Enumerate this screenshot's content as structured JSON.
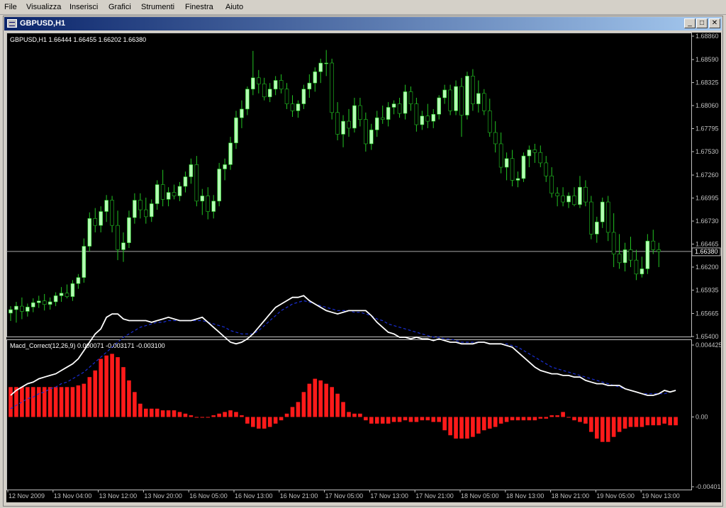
{
  "menu": [
    "File",
    "Visualizza",
    "Inserisci",
    "Grafici",
    "Strumenti",
    "Finestra",
    "Aiuto"
  ],
  "window": {
    "title": "GBPUSD,H1",
    "minimize": "_",
    "maximize": "□",
    "close": "✕"
  },
  "colors": {
    "background": "#000000",
    "bull": "#b3ffb3",
    "wick": "#22c422",
    "histogram": "#ff1a1a",
    "macd_line": "#ffffff",
    "signal_line": "#1a2ed6",
    "axis": "#c0c0c0"
  },
  "price_panel": {
    "label": "GBPUSD,H1  1.66444 1.66455 1.66202 1.66380",
    "price_ticks": [
      "1.68860",
      "1.68590",
      "1.68325",
      "1.68060",
      "1.67795",
      "1.67530",
      "1.67260",
      "1.66995",
      "1.66730",
      "1.66465",
      "1.66200",
      "1.65935",
      "1.65665",
      "1.65400"
    ],
    "current_price": "1.66380"
  },
  "macd_panel": {
    "label": "Macd_Correct(12,26,9) 0.000071 -0.003171 -0.003100",
    "ticks": [
      "0.004425",
      "0.00",
      "-0.00401"
    ]
  },
  "time_ticks": [
    "12 Nov 2009",
    "13 Nov 04:00",
    "13 Nov 12:00",
    "13 Nov 20:00",
    "16 Nov 05:00",
    "16 Nov 13:00",
    "16 Nov 21:00",
    "17 Nov 05:00",
    "17 Nov 13:00",
    "17 Nov 21:00",
    "18 Nov 05:00",
    "18 Nov 13:00",
    "18 Nov 21:00",
    "19 Nov 05:00",
    "19 Nov 13:00"
  ],
  "chart_data": {
    "type": "candlestick",
    "symbol": "GBPUSD",
    "timeframe": "H1",
    "price_ylim": [
      1.654,
      1.6886
    ],
    "candles": [
      [
        1.6567,
        1.6575,
        1.6558,
        1.6571
      ],
      [
        1.6571,
        1.658,
        1.6556,
        1.6575
      ],
      [
        1.6575,
        1.6585,
        1.656,
        1.6569
      ],
      [
        1.6569,
        1.6578,
        1.6563,
        1.6574
      ],
      [
        1.6574,
        1.6584,
        1.6568,
        1.6579
      ],
      [
        1.6579,
        1.6587,
        1.6573,
        1.6581
      ],
      [
        1.6581,
        1.6589,
        1.657,
        1.6577
      ],
      [
        1.6577,
        1.6585,
        1.6571,
        1.658
      ],
      [
        1.658,
        1.6591,
        1.6575,
        1.6587
      ],
      [
        1.6587,
        1.6597,
        1.658,
        1.659
      ],
      [
        1.659,
        1.66,
        1.6584,
        1.6586
      ],
      [
        1.6586,
        1.6605,
        1.6581,
        1.6601
      ],
      [
        1.6601,
        1.6612,
        1.6595,
        1.6608
      ],
      [
        1.6608,
        1.6653,
        1.6602,
        1.6644
      ],
      [
        1.6644,
        1.6683,
        1.6638,
        1.6676
      ],
      [
        1.6676,
        1.6688,
        1.666,
        1.6668
      ],
      [
        1.6668,
        1.669,
        1.666,
        1.6684
      ],
      [
        1.6684,
        1.6703,
        1.6672,
        1.6697
      ],
      [
        1.6697,
        1.6702,
        1.666,
        1.6668
      ],
      [
        1.6668,
        1.6685,
        1.6628,
        1.664
      ],
      [
        1.664,
        1.666,
        1.6626,
        1.6648
      ],
      [
        1.6648,
        1.6685,
        1.6642,
        1.6677
      ],
      [
        1.6677,
        1.6705,
        1.667,
        1.6697
      ],
      [
        1.6697,
        1.6705,
        1.6676,
        1.6686
      ],
      [
        1.6686,
        1.67,
        1.667,
        1.6678
      ],
      [
        1.6678,
        1.6698,
        1.6672,
        1.6693
      ],
      [
        1.6693,
        1.672,
        1.6686,
        1.6715
      ],
      [
        1.6715,
        1.6732,
        1.669,
        1.6698
      ],
      [
        1.6698,
        1.6712,
        1.669,
        1.6706
      ],
      [
        1.6706,
        1.6715,
        1.6698,
        1.6702
      ],
      [
        1.6702,
        1.6718,
        1.6696,
        1.6713
      ],
      [
        1.6713,
        1.673,
        1.6706,
        1.6724
      ],
      [
        1.6724,
        1.6745,
        1.6716,
        1.6738
      ],
      [
        1.6738,
        1.6748,
        1.669,
        1.6696
      ],
      [
        1.6696,
        1.671,
        1.668,
        1.6702
      ],
      [
        1.6702,
        1.6712,
        1.6675,
        1.6684
      ],
      [
        1.6684,
        1.6703,
        1.6676,
        1.6696
      ],
      [
        1.6696,
        1.674,
        1.669,
        1.6733
      ],
      [
        1.6733,
        1.6745,
        1.672,
        1.6738
      ],
      [
        1.6738,
        1.677,
        1.6732,
        1.6763
      ],
      [
        1.6763,
        1.68,
        1.6756,
        1.6792
      ],
      [
        1.6792,
        1.6812,
        1.678,
        1.6802
      ],
      [
        1.6802,
        1.6828,
        1.6795,
        1.6825
      ],
      [
        1.6825,
        1.6869,
        1.6818,
        1.6838
      ],
      [
        1.6838,
        1.6847,
        1.682,
        1.6831
      ],
      [
        1.6831,
        1.6838,
        1.6812,
        1.6816
      ],
      [
        1.6816,
        1.6832,
        1.681,
        1.6825
      ],
      [
        1.6825,
        1.684,
        1.6818,
        1.6835
      ],
      [
        1.6835,
        1.6842,
        1.682,
        1.6825
      ],
      [
        1.6825,
        1.6832,
        1.6802,
        1.6808
      ],
      [
        1.6808,
        1.6818,
        1.6793,
        1.68
      ],
      [
        1.68,
        1.6812,
        1.6792,
        1.6808
      ],
      [
        1.6808,
        1.683,
        1.6802,
        1.6825
      ],
      [
        1.6825,
        1.6842,
        1.6815,
        1.6832
      ],
      [
        1.6832,
        1.685,
        1.6822,
        1.6845
      ],
      [
        1.6845,
        1.686,
        1.6832,
        1.6855
      ],
      [
        1.6855,
        1.687,
        1.684,
        1.6855
      ],
      [
        1.6855,
        1.686,
        1.679,
        1.6798
      ],
      [
        1.6798,
        1.681,
        1.6766,
        1.6773
      ],
      [
        1.6773,
        1.6795,
        1.6758,
        1.6788
      ],
      [
        1.6788,
        1.6802,
        1.677,
        1.678
      ],
      [
        1.678,
        1.6815,
        1.6775,
        1.6806
      ],
      [
        1.6806,
        1.6815,
        1.6782,
        1.679
      ],
      [
        1.679,
        1.6798,
        1.6753,
        1.6762
      ],
      [
        1.6762,
        1.6785,
        1.6755,
        1.6778
      ],
      [
        1.6778,
        1.68,
        1.677,
        1.6792
      ],
      [
        1.6792,
        1.6806,
        1.6785,
        1.679
      ],
      [
        1.679,
        1.681,
        1.6782,
        1.6804
      ],
      [
        1.6804,
        1.6812,
        1.6796,
        1.6808
      ],
      [
        1.6808,
        1.6815,
        1.6792,
        1.6797
      ],
      [
        1.6797,
        1.683,
        1.679,
        1.6822
      ],
      [
        1.6822,
        1.6828,
        1.68,
        1.6808
      ],
      [
        1.6808,
        1.6815,
        1.6776,
        1.6784
      ],
      [
        1.6784,
        1.68,
        1.6778,
        1.6794
      ],
      [
        1.6794,
        1.6808,
        1.678,
        1.6788
      ],
      [
        1.6788,
        1.6802,
        1.678,
        1.6796
      ],
      [
        1.6796,
        1.6818,
        1.679,
        1.6815
      ],
      [
        1.6815,
        1.683,
        1.6808,
        1.6824
      ],
      [
        1.6824,
        1.683,
        1.6795,
        1.68
      ],
      [
        1.68,
        1.6835,
        1.6795,
        1.6828
      ],
      [
        1.6828,
        1.6838,
        1.677,
        1.6795
      ],
      [
        1.6795,
        1.6845,
        1.679,
        1.684
      ],
      [
        1.684,
        1.6848,
        1.68,
        1.6808
      ],
      [
        1.6808,
        1.6835,
        1.6798,
        1.682
      ],
      [
        1.682,
        1.6825,
        1.6795,
        1.68
      ],
      [
        1.68,
        1.6814,
        1.677,
        1.6775
      ],
      [
        1.6775,
        1.6788,
        1.6752,
        1.6762
      ],
      [
        1.6762,
        1.6775,
        1.6728,
        1.6735
      ],
      [
        1.6735,
        1.6752,
        1.672,
        1.6745
      ],
      [
        1.6745,
        1.6755,
        1.6713,
        1.672
      ],
      [
        1.672,
        1.673,
        1.6712,
        1.6722
      ],
      [
        1.6722,
        1.6752,
        1.6718,
        1.6748
      ],
      [
        1.6748,
        1.676,
        1.6735,
        1.6755
      ],
      [
        1.6755,
        1.6762,
        1.674,
        1.6752
      ],
      [
        1.6752,
        1.676,
        1.6735,
        1.674
      ],
      [
        1.674,
        1.6748,
        1.6718,
        1.6725
      ],
      [
        1.6725,
        1.6735,
        1.67,
        1.6705
      ],
      [
        1.6705,
        1.6712,
        1.669,
        1.6702
      ],
      [
        1.6702,
        1.6712,
        1.669,
        1.6695
      ],
      [
        1.6695,
        1.6706,
        1.6688,
        1.6702
      ],
      [
        1.6702,
        1.6712,
        1.669,
        1.6692
      ],
      [
        1.6692,
        1.6725,
        1.6688,
        1.6712
      ],
      [
        1.6712,
        1.672,
        1.669,
        1.6695
      ],
      [
        1.6695,
        1.6702,
        1.6652,
        1.6658
      ],
      [
        1.6658,
        1.6678,
        1.6648,
        1.6672
      ],
      [
        1.6672,
        1.67,
        1.6665,
        1.6695
      ],
      [
        1.6695,
        1.6702,
        1.665,
        1.666
      ],
      [
        1.666,
        1.6682,
        1.662,
        1.6635
      ],
      [
        1.6635,
        1.6658,
        1.6618,
        1.6625
      ],
      [
        1.6625,
        1.6648,
        1.6615,
        1.664
      ],
      [
        1.664,
        1.6655,
        1.662,
        1.6628
      ],
      [
        1.6628,
        1.664,
        1.6605,
        1.6612
      ],
      [
        1.6612,
        1.6632,
        1.6608,
        1.6618
      ],
      [
        1.6618,
        1.6658,
        1.6612,
        1.665
      ],
      [
        1.665,
        1.6663,
        1.6635,
        1.664
      ],
      [
        1.664,
        1.6648,
        1.662,
        1.6638
      ]
    ],
    "macd": [
      0.0013,
      0.0016,
      0.0018,
      0.002,
      0.0021,
      0.0023,
      0.0024,
      0.0025,
      0.0026,
      0.0028,
      0.003,
      0.0032,
      0.0035,
      0.004,
      0.0045,
      0.005,
      0.0053,
      0.006,
      0.0062,
      0.0062,
      0.0059,
      0.0058,
      0.0058,
      0.0058,
      0.0058,
      0.0057,
      0.0058,
      0.0059,
      0.006,
      0.0059,
      0.0058,
      0.0058,
      0.0058,
      0.0059,
      0.006,
      0.0057,
      0.0054,
      0.0051,
      0.0048,
      0.0045,
      0.0044,
      0.0045,
      0.0047,
      0.005,
      0.0054,
      0.0058,
      0.0062,
      0.0066,
      0.0068,
      0.007,
      0.0072,
      0.0072,
      0.0073,
      0.007,
      0.0068,
      0.0066,
      0.0064,
      0.0063,
      0.0062,
      0.0063,
      0.0064,
      0.0064,
      0.0064,
      0.0064,
      0.0061,
      0.0057,
      0.0054,
      0.0051,
      0.005,
      0.0048,
      0.0048,
      0.0047,
      0.0048,
      0.0047,
      0.0047,
      0.0046,
      0.0047,
      0.0046,
      0.0045,
      0.0045,
      0.0044,
      0.0044,
      0.0044,
      0.0045,
      0.0045,
      0.0044,
      0.0044,
      0.0044,
      0.0043,
      0.0042,
      0.0039,
      0.0036,
      0.0033,
      0.003,
      0.0028,
      0.0027,
      0.0026,
      0.0026,
      0.0025,
      0.0025,
      0.0024,
      0.0024,
      0.0022,
      0.0021,
      0.002,
      0.002,
      0.0019,
      0.0019,
      0.0019,
      0.0017,
      0.0016,
      0.0015,
      0.0014,
      0.0013,
      0.0013,
      0.0014,
      0.0016,
      0.0015,
      0.0016
    ],
    "signal": [
      0.0005,
      0.0007,
      0.0009,
      0.0011,
      0.0012,
      0.0014,
      0.0015,
      0.0017,
      0.0018,
      0.002,
      0.0021,
      0.0023,
      0.0025,
      0.0027,
      0.003,
      0.0033,
      0.0036,
      0.0039,
      0.0042,
      0.0045,
      0.0048,
      0.005,
      0.0052,
      0.0054,
      0.0055,
      0.0056,
      0.0057,
      0.0057,
      0.0058,
      0.0058,
      0.0058,
      0.0058,
      0.0058,
      0.0058,
      0.0058,
      0.0057,
      0.0056,
      0.0055,
      0.0054,
      0.0052,
      0.0051,
      0.005,
      0.005,
      0.005,
      0.0052,
      0.0055,
      0.0058,
      0.0061,
      0.0064,
      0.0066,
      0.0068,
      0.0069,
      0.007,
      0.0069,
      0.0068,
      0.0067,
      0.0066,
      0.0065,
      0.0064,
      0.0064,
      0.0064,
      0.0063,
      0.0063,
      0.0062,
      0.0061,
      0.0059,
      0.0058,
      0.0056,
      0.0055,
      0.0054,
      0.0053,
      0.0052,
      0.0051,
      0.005,
      0.0049,
      0.0048,
      0.0048,
      0.0047,
      0.0047,
      0.0046,
      0.0045,
      0.0045,
      0.0045,
      0.0045,
      0.0045,
      0.0044,
      0.0044,
      0.0044,
      0.0044,
      0.0043,
      0.0042,
      0.004,
      0.0038,
      0.0036,
      0.0034,
      0.0032,
      0.003,
      0.0029,
      0.0028,
      0.0027,
      0.0026,
      0.0025,
      0.0024,
      0.0023,
      0.0022,
      0.0021,
      0.002,
      0.0019,
      0.0018,
      0.0017,
      0.0016,
      0.0015,
      0.0014,
      0.0014,
      0.0014,
      0.0014,
      0.0014,
      0.0015,
      0.0016
    ],
    "histogram": [
      0.0018,
      0.0018,
      0.0018,
      0.0018,
      0.0018,
      0.0018,
      0.0018,
      0.0018,
      0.0018,
      0.0018,
      0.0018,
      0.0018,
      0.0019,
      0.002,
      0.0024,
      0.0028,
      0.0035,
      0.0037,
      0.0038,
      0.0036,
      0.003,
      0.0022,
      0.0015,
      0.0008,
      0.0005,
      0.0005,
      0.0005,
      0.0004,
      0.0004,
      0.0004,
      0.0003,
      0.0002,
      0.0001,
      0.0,
      0.0,
      0.0,
      0.0001,
      0.0002,
      0.0003,
      0.0004,
      0.0003,
      0.0001,
      -0.0004,
      -0.0006,
      -0.0007,
      -0.0007,
      -0.0006,
      -0.0004,
      -0.0002,
      0.0002,
      0.0006,
      0.0009,
      0.0015,
      0.002,
      0.0023,
      0.0022,
      0.002,
      0.0018,
      0.0014,
      0.0009,
      0.0003,
      0.0002,
      0.0002,
      -0.0002,
      -0.0004,
      -0.0004,
      -0.0004,
      -0.0004,
      -0.0003,
      -0.0003,
      -0.0002,
      -0.0003,
      -0.0003,
      -0.0002,
      -0.0002,
      -0.0003,
      -0.0003,
      -0.0008,
      -0.0011,
      -0.0013,
      -0.0013,
      -0.0013,
      -0.0012,
      -0.001,
      -0.0008,
      -0.0007,
      -0.0006,
      -0.0004,
      -0.0003,
      -0.0002,
      -0.0002,
      -0.0002,
      -0.0002,
      -0.0002,
      -0.0001,
      -0.0001,
      0.0001,
      0.0001,
      0.0003,
      0.0,
      -0.0002,
      -0.0003,
      -0.0004,
      -0.0009,
      -0.0013,
      -0.0015,
      -0.0015,
      -0.0012,
      -0.0009,
      -0.0007,
      -0.0006,
      -0.0006,
      -0.0006,
      -0.0005,
      -0.0005,
      -0.0005,
      -0.0004,
      -0.0005,
      -0.0005
    ],
    "macd_ylim": [
      -0.0042,
      0.0045
    ]
  }
}
